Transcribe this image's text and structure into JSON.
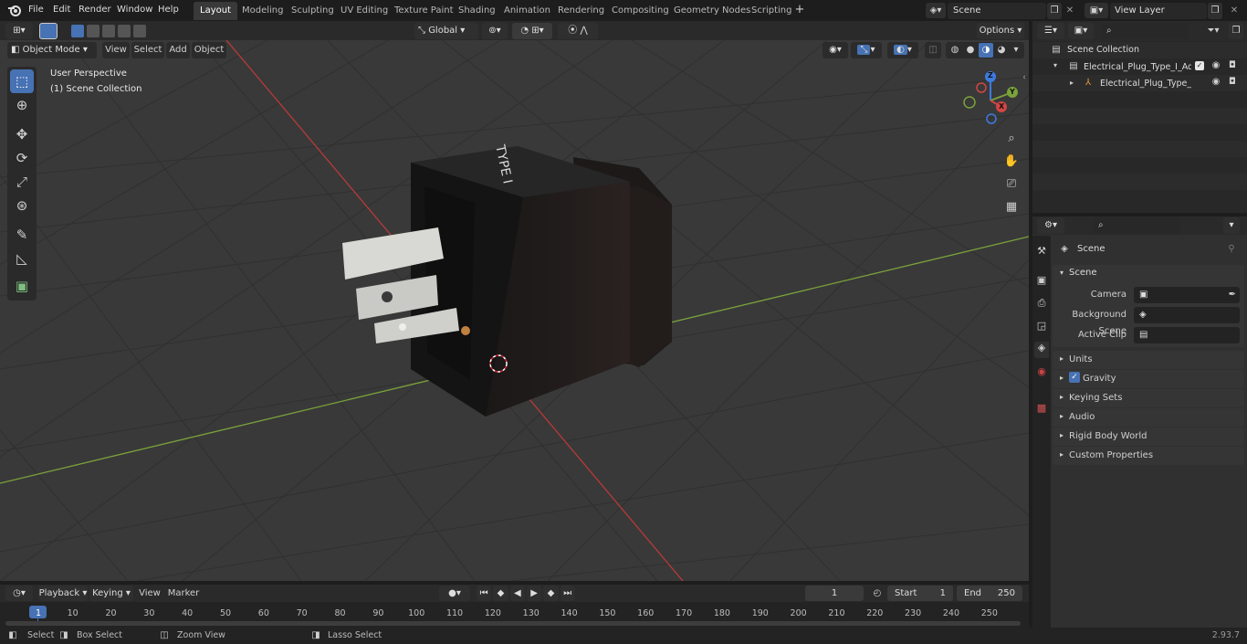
{
  "menubar": {
    "items": [
      "File",
      "Edit",
      "Render",
      "Window",
      "Help"
    ]
  },
  "workspaces": [
    "Layout",
    "Modeling",
    "Sculpting",
    "UV Editing",
    "Texture Paint",
    "Shading",
    "Animation",
    "Rendering",
    "Compositing",
    "Geometry Nodes",
    "Scripting"
  ],
  "active_workspace": "Layout",
  "scene_field": "Scene",
  "view_layer_field": "View Layer",
  "viewport": {
    "mode": "Object Mode",
    "menus": [
      "View",
      "Select",
      "Add",
      "Object"
    ],
    "transform": "Global",
    "options": "Options",
    "perspective": "User Perspective",
    "collection": "(1) Scene Collection",
    "decal_text": "TYPE I"
  },
  "gizmo": {
    "x": "X",
    "y": "Y",
    "z": "Z"
  },
  "outliner": {
    "root": "Scene Collection",
    "items": [
      "Electrical_Plug_Type_I_Adapte",
      "Electrical_Plug_Type_I_Ac"
    ]
  },
  "properties": {
    "context": "Scene",
    "panel": "Scene",
    "camera_label": "Camera",
    "background_label": "Background Scene",
    "clip_label": "Active Clip",
    "sections": [
      "Units",
      "Gravity",
      "Keying Sets",
      "Audio",
      "Rigid Body World",
      "Custom Properties"
    ]
  },
  "timeline": {
    "menus": [
      "Playback",
      "Keying",
      "View",
      "Marker"
    ],
    "frame": "1",
    "start_label": "Start",
    "start": "1",
    "end_label": "End",
    "end": "250",
    "ticks": [
      "1",
      "10",
      "20",
      "30",
      "40",
      "50",
      "60",
      "70",
      "80",
      "90",
      "100",
      "110",
      "120",
      "130",
      "140",
      "150",
      "160",
      "170",
      "180",
      "190",
      "200",
      "210",
      "220",
      "230",
      "240",
      "250"
    ]
  },
  "statusbar": {
    "select": "Select",
    "box_select": "Box Select",
    "zoom_view": "Zoom View",
    "lasso_select": "Lasso Select",
    "version": "2.93.7"
  },
  "colors": {
    "accent": "#4772b3",
    "x_axis": "#b83a3a",
    "y_axis": "#7aa23a",
    "viewport_bg": "#393939"
  }
}
